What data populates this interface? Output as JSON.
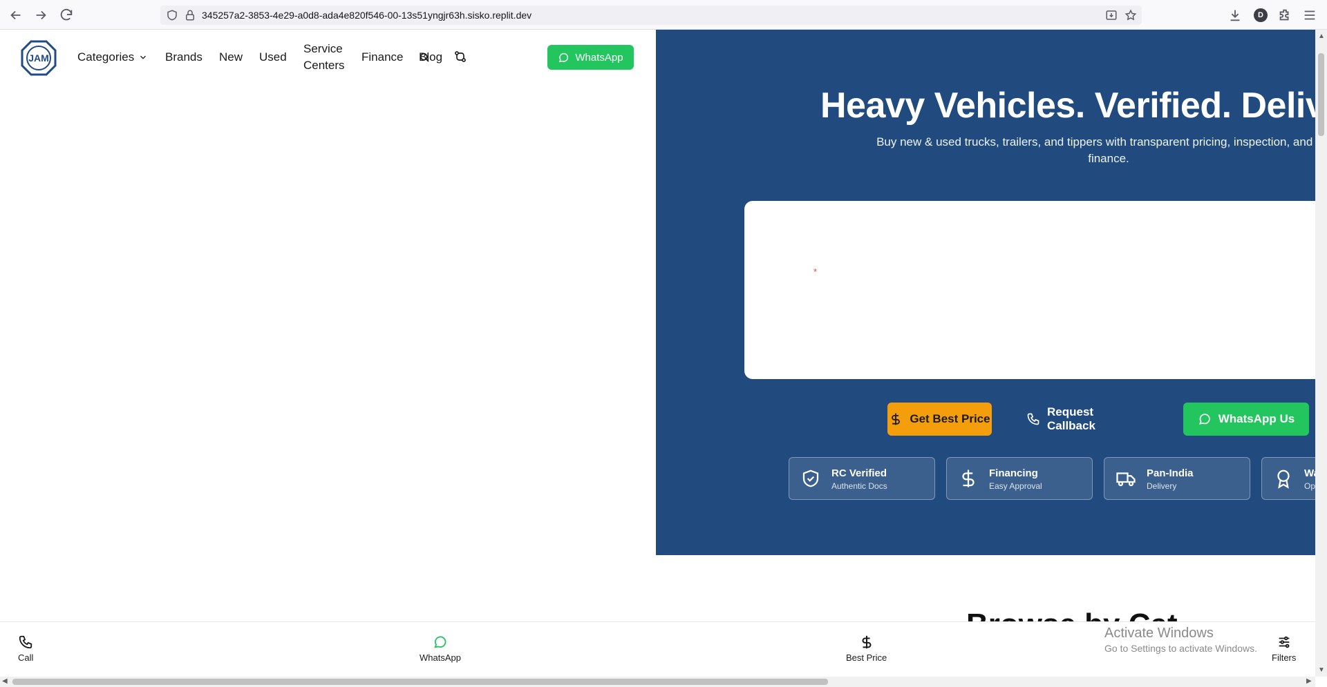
{
  "browser": {
    "url": "345257a2-3853-4e29-a0d8-ada4e820f546-00-13s51yngjr63h.sisko.replit.dev",
    "profile_initial": "D"
  },
  "header": {
    "logo_text": "JAM",
    "nav": {
      "categories": "Categories",
      "brands": "Brands",
      "new": "New",
      "used": "Used",
      "service_centers_line1": "Service",
      "service_centers_line2": "Centers",
      "finance": "Finance",
      "blog": "Blog"
    },
    "whatsapp_label": "WhatsApp"
  },
  "hero": {
    "title": "Heavy Vehicles. Verified. Delivered.",
    "subtitle": "Buy new & used trucks, trailers, and tippers with transparent pricing, inspection, and easy finance.",
    "cta": {
      "best_price": "Get Best Price",
      "callback": "Request Callback",
      "whatsapp": "WhatsApp Us"
    },
    "badges": [
      {
        "title": "RC Verified",
        "subtitle": "Authentic Docs",
        "icon": "shield-check-icon"
      },
      {
        "title": "Financing",
        "subtitle": "Easy Approval",
        "icon": "dollar-icon"
      },
      {
        "title": "Pan-India",
        "subtitle": "Delivery",
        "icon": "truck-icon"
      },
      {
        "title": "Wa",
        "subtitle": "Op",
        "icon": "award-icon"
      }
    ]
  },
  "section_peek": "Browse by Cat",
  "bottom_bar": {
    "call": "Call",
    "whatsapp": "WhatsApp",
    "best_price": "Best Price",
    "filters": "Filters"
  },
  "watermark": {
    "title": "Activate Windows",
    "subtitle": "Go to Settings to activate Windows."
  },
  "colors": {
    "hero_bg": "#214b7f",
    "whatsapp_green": "#22c55e",
    "price_orange": "#f59e0b"
  }
}
